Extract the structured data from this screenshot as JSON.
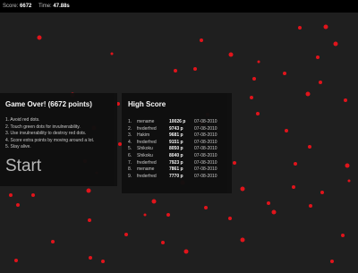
{
  "status": {
    "score_label": "Score:",
    "score_value": "6672",
    "time_label": "Time:",
    "time_value": "47.88s"
  },
  "game_over": {
    "title": "Game Over! (6672 points)",
    "rules": [
      "1. Avoid red dots.",
      "2. Touch green dots for invulnerability.",
      "3. Use invulnerability to destroy red dots.",
      "4. Score extra points by moving around a lot.",
      "5. Stay alive."
    ],
    "start_label": "Start"
  },
  "high_score": {
    "title": "High Score",
    "rows": [
      {
        "rank": "1.",
        "name": "mename",
        "points": "10026 p",
        "date": "07-08-2010"
      },
      {
        "rank": "2.",
        "name": "frederfred",
        "points": "9743 p",
        "date": "07-08-2010"
      },
      {
        "rank": "3.",
        "name": "Hakim",
        "points": "9681 p",
        "date": "07-08-2010"
      },
      {
        "rank": "4.",
        "name": "frederfred",
        "points": "9151 p",
        "date": "07-08-2010"
      },
      {
        "rank": "5.",
        "name": "Shikoku",
        "points": "8050 p",
        "date": "07-08-2010"
      },
      {
        "rank": "6.",
        "name": "Shikoku",
        "points": "8040 p",
        "date": "07-08-2010"
      },
      {
        "rank": "7.",
        "name": "frederfred",
        "points": "7923 p",
        "date": "07-08-2010"
      },
      {
        "rank": "8.",
        "name": "mename",
        "points": "7861 p",
        "date": "07-08-2010"
      },
      {
        "rank": "9.",
        "name": "frederfred",
        "points": "7770 p",
        "date": "07-08-2010"
      }
    ]
  },
  "colors": {
    "background": "#1f1f1f",
    "dot": "#e0141b",
    "panel": "#0f0f0f"
  }
}
